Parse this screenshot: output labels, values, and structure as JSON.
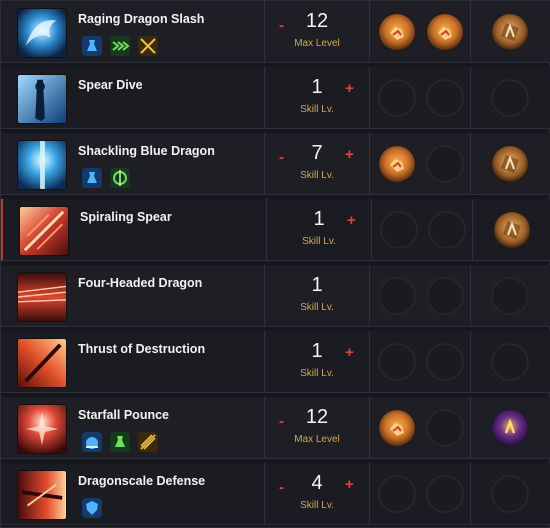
{
  "skills": [
    {
      "name": "Raging Dragon Slash",
      "level": "12",
      "level_label": "Max Level",
      "show_minus": true,
      "show_plus": false,
      "icon": "dragon-slash-icon",
      "tripods": [
        "blue-potion-icon",
        "green-arrows-icon",
        "gold-crossed-swords-icon"
      ],
      "gems": [
        "orange-gem-icon",
        "orange-gem-icon",
        "rune-icon"
      ]
    },
    {
      "name": "Spear Dive",
      "level": "1",
      "level_label": "Skill Lv.",
      "show_minus": false,
      "show_plus": true,
      "icon": "spear-dive-icon",
      "tripods": [],
      "gems": [
        "",
        "",
        ""
      ]
    },
    {
      "name": "Shackling Blue Dragon",
      "level": "7",
      "level_label": "Skill Lv.",
      "show_minus": true,
      "show_plus": true,
      "icon": "blue-dragon-icon",
      "tripods": [
        "blue-potion-icon",
        "green-swirl-icon"
      ],
      "gems": [
        "orange-gem-icon",
        "",
        "rune-icon"
      ]
    },
    {
      "name": "Spiraling Spear",
      "level": "1",
      "level_label": "Skill Lv.",
      "show_minus": false,
      "show_plus": true,
      "icon": "spiral-spear-icon",
      "tripods": [],
      "gems": [
        "",
        "",
        "rune-icon"
      ]
    },
    {
      "name": "Four-Headed Dragon",
      "level": "1",
      "level_label": "Skill Lv.",
      "show_minus": false,
      "show_plus": false,
      "icon": "four-dragon-icon",
      "tripods": [],
      "gems": [
        "",
        "",
        ""
      ]
    },
    {
      "name": "Thrust of Destruction",
      "level": "1",
      "level_label": "Skill Lv.",
      "show_minus": false,
      "show_plus": true,
      "icon": "thrust-icon",
      "tripods": [],
      "gems": [
        "",
        "",
        ""
      ]
    },
    {
      "name": "Starfall Pounce",
      "level": "12",
      "level_label": "Max Level",
      "show_minus": true,
      "show_plus": false,
      "icon": "starfall-icon",
      "tripods": [
        "blue-burst-icon",
        "green-potion-icon",
        "gold-blade-icon"
      ],
      "gems": [
        "orange-gem-icon",
        "",
        "purple-rune-icon"
      ]
    },
    {
      "name": "Dragonscale Defense",
      "level": "4",
      "level_label": "Skill Lv.",
      "show_minus": true,
      "show_plus": true,
      "icon": "dragonscale-icon",
      "tripods": [
        "blue-shield-icon"
      ],
      "gems": [
        "",
        "",
        ""
      ]
    }
  ],
  "colors": {
    "accent_red": "#e0433a",
    "label_gold": "#d4a64a",
    "row_bg": "#1d1f25",
    "gem_orange": "#c9712a",
    "rune_purple": "#6a2f8e"
  }
}
